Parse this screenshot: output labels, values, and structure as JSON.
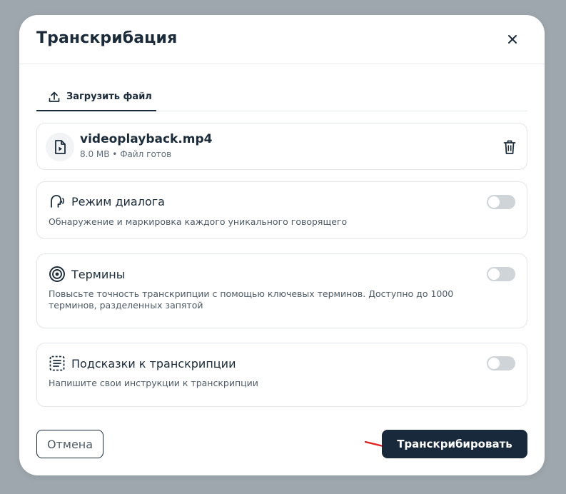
{
  "modal": {
    "title": "Транскрибация"
  },
  "tabs": [
    {
      "label": "Загрузить файл",
      "icon": "upload-icon",
      "active": true
    }
  ],
  "file": {
    "name": "videoplayback.mp4",
    "meta": "8.0 MB • Файл готов",
    "icon": "video-file-icon"
  },
  "options": {
    "dialog": {
      "title": "Режим диалога",
      "description": "Обнаружение и маркировка каждого уникального говорящего",
      "icon": "speaker-head-icon",
      "enabled": false
    },
    "terms": {
      "title": "Термины",
      "description": "Повысьте точность транскрипции с помощью ключевых терминов. Доступно до 1000 терминов, разделенных запятой",
      "icon": "target-icon",
      "enabled": false
    },
    "hints": {
      "title": "Подсказки к транскрипции",
      "description": "Напишите свои инструкции к транскрипции",
      "icon": "list-frame-icon",
      "enabled": false
    }
  },
  "actions": {
    "cancel_label": "Отмена",
    "submit_label": "Транскрибировать"
  },
  "colors": {
    "backdrop": "#9ea7ad",
    "primary": "#17293a",
    "toggle_off": "#cfd4d8",
    "annotation_arrow": "#e11d1d"
  }
}
